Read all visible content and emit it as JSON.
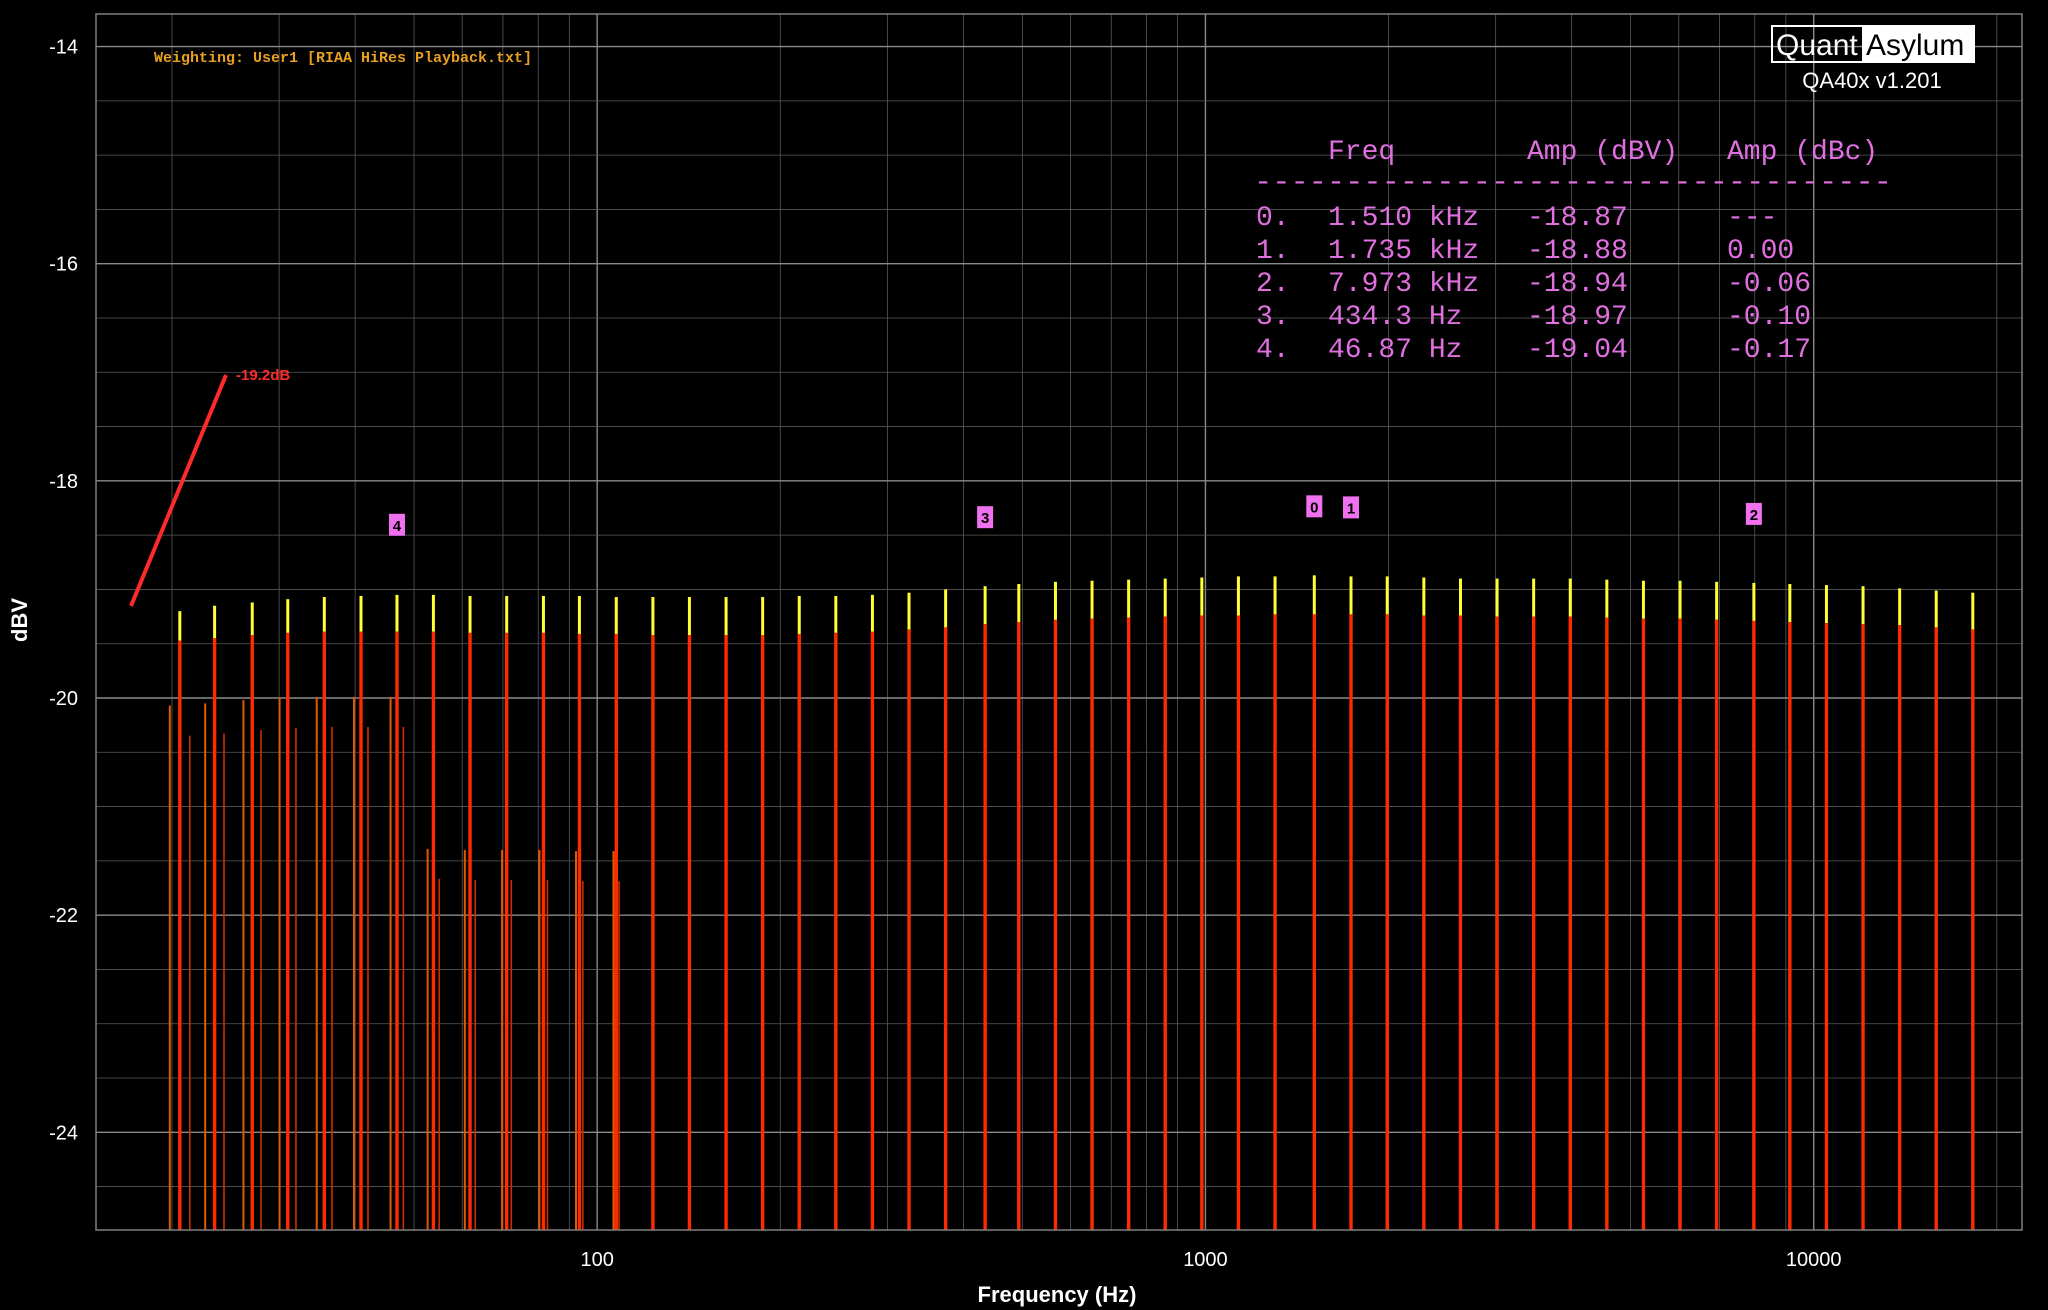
{
  "logo": {
    "left": "Quant",
    "right": "Asylum",
    "version": "QA40x v1.201"
  },
  "weighting_label": "Weighting: User1 [RIAA HiRes Playback.txt]",
  "annotation": "-19.2dB",
  "marker_table": {
    "header": [
      "Freq",
      "Amp (dBV)",
      "Amp (dBc)"
    ],
    "separator": "-----------------------------------",
    "rows": [
      {
        "idx": "0.",
        "freq": "1.510 kHz",
        "dbv": "-18.87",
        "dbc": "---"
      },
      {
        "idx": "1.",
        "freq": "1.735 kHz",
        "dbv": "-18.88",
        "dbc": "0.00"
      },
      {
        "idx": "2.",
        "freq": "7.973 kHz",
        "dbv": "-18.94",
        "dbc": "-0.06"
      },
      {
        "idx": "3.",
        "freq": "434.3 Hz",
        "dbv": "-18.97",
        "dbc": "-0.10"
      },
      {
        "idx": "4.",
        "freq": "46.87 Hz",
        "dbv": "-19.04",
        "dbc": "-0.17"
      }
    ]
  },
  "colors": {
    "background": "#000000",
    "grid": "#5a5a5a",
    "trace_left": "#ffff33",
    "trace_right": "#ff2a00",
    "marker": "#f070f0"
  },
  "chart_data": {
    "type": "line",
    "xlabel": "Frequency (Hz)",
    "ylabel": "dBV",
    "x_scale": "log",
    "xlim": [
      15,
      22000
    ],
    "ylim": [
      -24.9,
      -13.7
    ],
    "x_ticks": [
      {
        "v": 100,
        "label": "100"
      },
      {
        "v": 1000,
        "label": "1000"
      },
      {
        "v": 10000,
        "label": "10000"
      }
    ],
    "y_ticks": [
      {
        "v": -14,
        "label": "-14"
      },
      {
        "v": -16,
        "label": "-16"
      },
      {
        "v": -18,
        "label": "-18"
      },
      {
        "v": -20,
        "label": "-20"
      },
      {
        "v": -22,
        "label": "-22"
      },
      {
        "v": -24,
        "label": "-24"
      }
    ],
    "grid": true,
    "tone_frequencies": [
      20.6,
      23.5,
      27.1,
      31.0,
      35.6,
      40.9,
      46.87,
      53.8,
      61.8,
      71.0,
      81.6,
      93.5,
      107.5,
      123.5,
      141.8,
      162.9,
      187.1,
      214.9,
      246.8,
      283.5,
      325.6,
      374.0,
      434.3,
      493.4,
      566.8,
      651.0,
      747.7,
      858.8,
      986.5,
      1133,
      1301.5,
      1510,
      1735,
      1990,
      2286,
      2626,
      3016,
      3464,
      3979,
      4570,
      5249,
      6029,
      6925,
      7973,
      9136,
      10494,
      12053,
      13845,
      15900,
      18262
    ],
    "tone_levels_left_dBV": [
      -19.2,
      -19.15,
      -19.12,
      -19.09,
      -19.07,
      -19.06,
      -19.05,
      -19.05,
      -19.06,
      -19.06,
      -19.06,
      -19.06,
      -19.07,
      -19.07,
      -19.07,
      -19.07,
      -19.07,
      -19.06,
      -19.06,
      -19.05,
      -19.03,
      -19.0,
      -18.97,
      -18.95,
      -18.93,
      -18.92,
      -18.91,
      -18.9,
      -18.89,
      -18.88,
      -18.88,
      -18.87,
      -18.88,
      -18.88,
      -18.89,
      -18.9,
      -18.9,
      -18.9,
      -18.9,
      -18.91,
      -18.92,
      -18.92,
      -18.93,
      -18.94,
      -18.95,
      -18.96,
      -18.97,
      -18.99,
      -19.01,
      -19.03
    ],
    "tone_levels_right_dBV": [
      -19.47,
      -19.45,
      -19.42,
      -19.4,
      -19.39,
      -19.39,
      -19.39,
      -19.39,
      -19.4,
      -19.4,
      -19.4,
      -19.41,
      -19.41,
      -19.42,
      -19.42,
      -19.42,
      -19.42,
      -19.41,
      -19.4,
      -19.39,
      -19.37,
      -19.35,
      -19.32,
      -19.3,
      -19.28,
      -19.27,
      -19.26,
      -19.25,
      -19.24,
      -19.24,
      -19.23,
      -19.23,
      -19.23,
      -19.23,
      -19.24,
      -19.24,
      -19.25,
      -19.25,
      -19.25,
      -19.26,
      -19.27,
      -19.27,
      -19.28,
      -19.29,
      -19.3,
      -19.31,
      -19.32,
      -19.33,
      -19.35,
      -19.37
    ],
    "markers": [
      {
        "label": "0",
        "freq": 1510,
        "dbv": -18.87
      },
      {
        "label": "1",
        "freq": 1735,
        "dbv": -18.88
      },
      {
        "label": "2",
        "freq": 7973,
        "dbv": -18.94
      },
      {
        "label": "3",
        "freq": 434.3,
        "dbv": -18.97
      },
      {
        "label": "4",
        "freq": 46.87,
        "dbv": -19.04
      }
    ]
  }
}
